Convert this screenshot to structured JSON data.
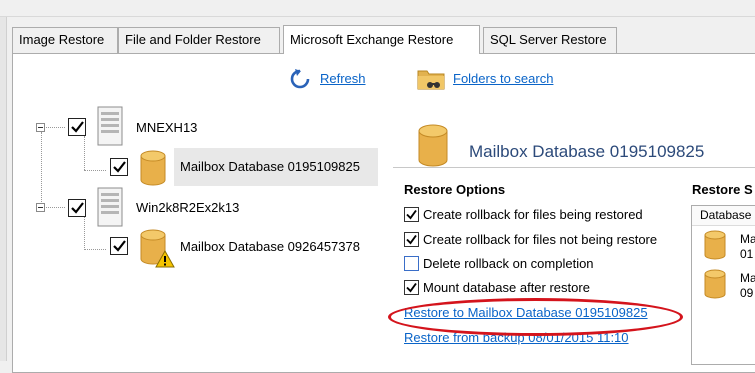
{
  "tabs": [
    {
      "label": "Image Restore"
    },
    {
      "label": "File and Folder Restore"
    },
    {
      "label": "Microsoft Exchange Restore"
    },
    {
      "label": "SQL Server Restore"
    }
  ],
  "toolbar": {
    "refresh_label": "Refresh",
    "folders_label": "Folders to search"
  },
  "tree": {
    "servers": [
      {
        "name": "MNEXH13",
        "database": "Mailbox Database 0195109825",
        "db_warning": false
      },
      {
        "name": "Win2k8R2Ex2k13",
        "database": "Mailbox Database 0926457378",
        "db_warning": true
      }
    ]
  },
  "detail": {
    "title": "Mailbox Database 0195109825",
    "options_heading": "Restore Options",
    "options": [
      {
        "label": "Create rollback for files being restored",
        "checked": true
      },
      {
        "label": "Create rollback for files not being restore",
        "checked": true
      },
      {
        "label": "Delete rollback on completion",
        "checked": false
      },
      {
        "label": "Mount database after restore",
        "checked": true
      }
    ],
    "restore_link": "Restore to Mailbox Database 0195109825",
    "backup_link": "Restore from backup 08/01/2015 11:10",
    "side_heading": "Restore S",
    "side_column": "Database",
    "side_items": [
      {
        "line1": "Ma",
        "line2": "01"
      },
      {
        "line1": "Ma",
        "line2": "09"
      }
    ]
  },
  "colors": {
    "link": "#0a64c8",
    "db_gold": "#e8b04a",
    "highlight": "#d4141c"
  }
}
